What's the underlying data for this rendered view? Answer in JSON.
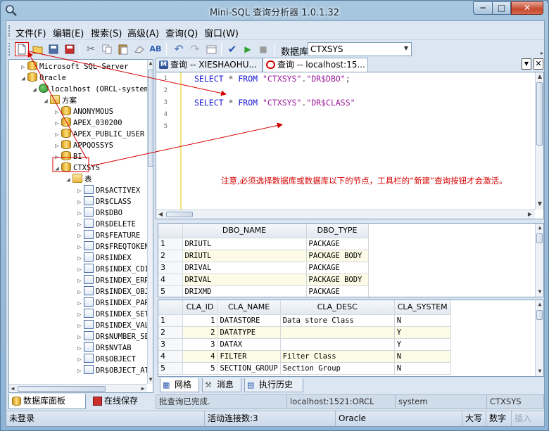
{
  "window": {
    "title": "Mini-SQL 查询分析器 1.0.1.32",
    "controls": {
      "minimize": "−",
      "maximize": "□",
      "close": "✕"
    }
  },
  "menu": [
    "文件(F)",
    "编辑(E)",
    "搜索(S)",
    "高级(A)",
    "查询(Q)",
    "窗口(W)"
  ],
  "toolbar": {
    "icons": [
      "new-query-icon",
      "open-icon",
      "save-icon",
      "save-all-icon",
      "cut-icon",
      "copy-icon",
      "paste-icon",
      "clear-icon",
      "spell-icon",
      "undo-icon",
      "redo-icon",
      "format-icon",
      "check-icon",
      "run-icon",
      "stop-icon"
    ],
    "database_label": "数据库",
    "database_value": "CTXSYS"
  },
  "tree": {
    "nodes": [
      {
        "label": "Microsoft SQL Server",
        "type": "db",
        "toggle": "▷"
      },
      {
        "label": "Oracle",
        "type": "db",
        "toggle": "◢"
      },
      {
        "label": "localhost (ORCL-system)",
        "type": "conn",
        "toggle": "◢"
      },
      {
        "label": "方案",
        "type": "folder",
        "toggle": "◢"
      },
      {
        "label": "ANONYMOUS",
        "type": "db",
        "toggle": "▷"
      },
      {
        "label": "APEX_030200",
        "type": "db",
        "toggle": "▷"
      },
      {
        "label": "APEX_PUBLIC_USER",
        "type": "db",
        "toggle": "▷"
      },
      {
        "label": "APPQOSSYS",
        "type": "db",
        "toggle": "▷"
      },
      {
        "label": "BI",
        "type": "db",
        "toggle": "▷"
      },
      {
        "label": "CTXSYS",
        "type": "db",
        "toggle": "◢"
      },
      {
        "label": "表",
        "type": "folder",
        "toggle": "◢"
      },
      {
        "label": "DR$ACTIVEX",
        "type": "table",
        "toggle": "▷"
      },
      {
        "label": "DR$CLASS",
        "type": "table",
        "toggle": "▷"
      },
      {
        "label": "DR$DBO",
        "type": "table",
        "toggle": "▷"
      },
      {
        "label": "DR$DELETE",
        "type": "table",
        "toggle": "▷"
      },
      {
        "label": "DR$FEATURE",
        "type": "table",
        "toggle": "▷"
      },
      {
        "label": "DR$FREQTOKEN",
        "type": "table",
        "toggle": "▷"
      },
      {
        "label": "DR$INDEX",
        "type": "table",
        "toggle": "▷"
      },
      {
        "label": "DR$INDEX_CDI",
        "type": "table",
        "toggle": "▷"
      },
      {
        "label": "DR$INDEX_ERROR",
        "type": "table",
        "toggle": "▷"
      },
      {
        "label": "DR$INDEX_OBJECT",
        "type": "table",
        "toggle": "▷"
      },
      {
        "label": "DR$INDEX_PART",
        "type": "table",
        "toggle": "▷"
      },
      {
        "label": "DR$INDEX_SET",
        "type": "table",
        "toggle": "▷"
      },
      {
        "label": "DR$INDEX_VALUE",
        "type": "table",
        "toggle": "▷"
      },
      {
        "label": "DR$NUMBER_SEQUENCE",
        "type": "table",
        "toggle": "▷"
      },
      {
        "label": "DR$NVTAB",
        "type": "table",
        "toggle": "▷"
      },
      {
        "label": "DR$OBJECT",
        "type": "table",
        "toggle": "▷"
      },
      {
        "label": "DR$OBJECT_ATTRIBUTE",
        "type": "table",
        "toggle": "▷"
      }
    ]
  },
  "left_tabs": [
    "数据库面板",
    "在线保存"
  ],
  "doc_tabs": [
    {
      "label": "查询 -- XIESHAOHU..."
    },
    {
      "label": "查询 -- localhost:15..."
    }
  ],
  "editor": {
    "line_numbers": [
      "1",
      "2",
      "3",
      "4",
      "5"
    ],
    "line1": {
      "kw": "SELECT",
      "star": "*",
      "kw2": "FROM",
      "s1": "\"CTXSYS\"",
      "dot": ".",
      "s2": "\"DR$DBO\"",
      "semi": ";"
    },
    "line3": {
      "kw": "SELECT",
      "star": "*",
      "kw2": "FROM",
      "s1": "\"CTXSYS\"",
      "dot": ".",
      "s2": "\"DR$CLASS\""
    },
    "note": "注意,必须选择数据库或数据库以下的节点，工具栏的“新建”查询按钮才会激活。"
  },
  "grid1": {
    "columns": [
      "DBO_NAME",
      "DBO_TYPE"
    ],
    "rows": [
      [
        "1",
        "DRIUTL",
        "PACKAGE"
      ],
      [
        "2",
        "DRIUTL",
        "PACKAGE BODY"
      ],
      [
        "3",
        "DRIVAL",
        "PACKAGE"
      ],
      [
        "4",
        "DRIVAL",
        "PACKAGE BODY"
      ],
      [
        "5",
        "DRIXMD",
        "PACKAGE"
      ]
    ]
  },
  "grid2": {
    "columns": [
      "CLA_ID",
      "CLA_NAME",
      "CLA_DESC",
      "CLA_SYSTEM"
    ],
    "rows": [
      [
        "1",
        "1",
        "DATASTORE",
        "Data store Class",
        "N"
      ],
      [
        "2",
        "2",
        "DATATYPE",
        "",
        "Y"
      ],
      [
        "3",
        "3",
        "DATAX",
        "",
        "Y"
      ],
      [
        "4",
        "4",
        "FILTER",
        "Filter Class",
        "N"
      ],
      [
        "5",
        "5",
        "SECTION_GROUP",
        "Section Group",
        "N"
      ]
    ]
  },
  "result_tabs": [
    "网格",
    "消息",
    "执行历史"
  ],
  "status_panel": [
    "批查询已完成.",
    "localhost:1521:ORCL",
    "system",
    "CTXSYS"
  ],
  "status_bar": {
    "login": "未登录",
    "connections": "活动连接数:3",
    "db": "Oracle",
    "caps": "大写",
    "num": "数字",
    "ins": "插入"
  },
  "colors": {
    "annotation_red": "#d40000",
    "keyword_blue": "#1717d3",
    "string_purple": "#9b1a9b"
  }
}
